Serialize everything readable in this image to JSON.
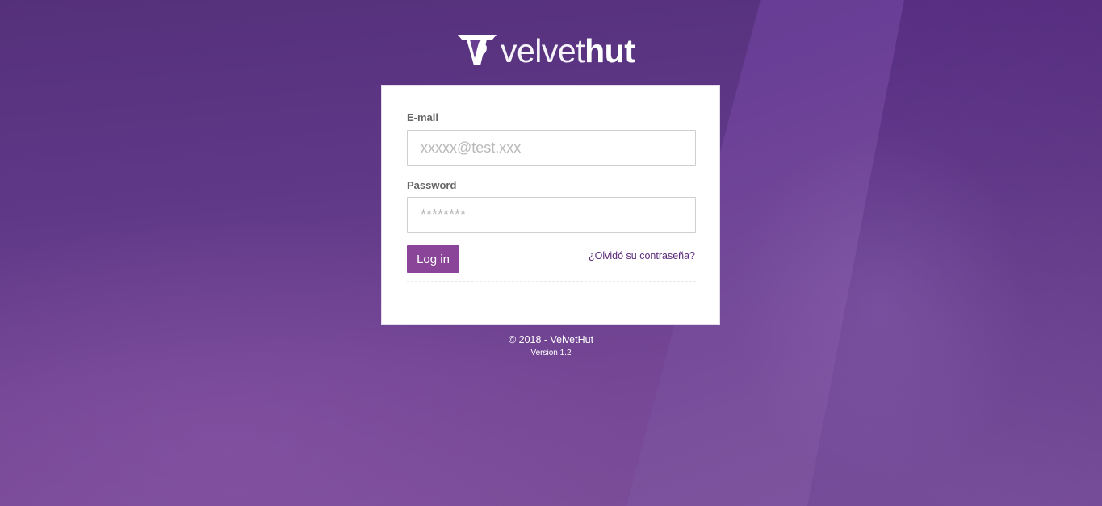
{
  "brand": {
    "name_light": "velvet",
    "name_bold": "hut",
    "logo_icon": "velvethut-logo-icon"
  },
  "login_form": {
    "email_label": "E-mail",
    "email_placeholder": "xxxxx@test.xxx",
    "email_value": "",
    "password_label": "Password",
    "password_placeholder": "********",
    "password_value": "",
    "login_button_label": "Log in",
    "forgot_password_link": "¿Olvidó su contraseña?"
  },
  "footer": {
    "copyright": "© 2018 - VelvetHut",
    "version": "Version 1.2"
  },
  "colors": {
    "background": "#5f3888",
    "button": "#8a4498",
    "link": "#5a2a7a",
    "card": "#ffffff"
  }
}
